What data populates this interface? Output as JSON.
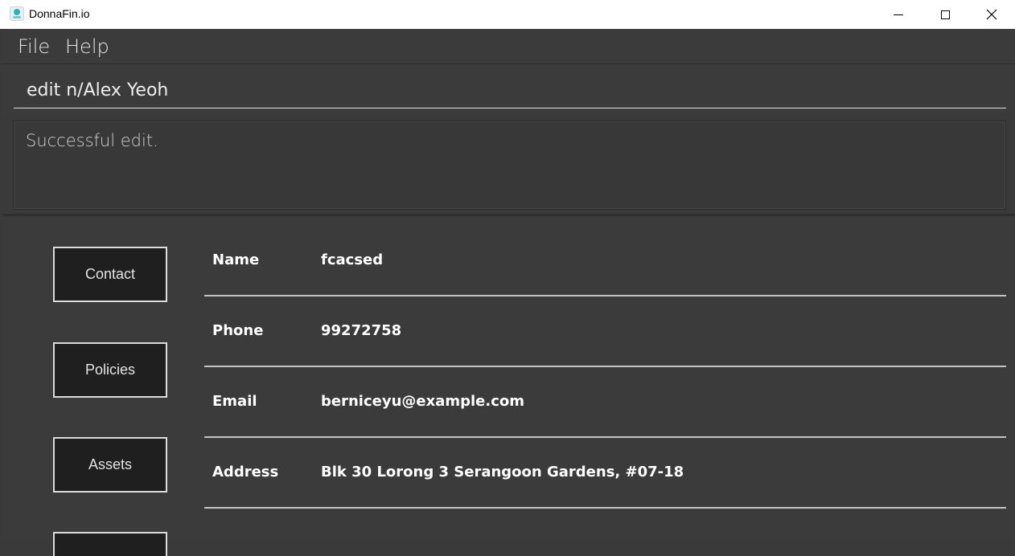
{
  "window": {
    "title": "DonnaFin.io"
  },
  "menu": {
    "file_label": "File",
    "help_label": "Help"
  },
  "command": {
    "value": "edit n/Alex Yeoh"
  },
  "result": {
    "message": "Successful edit."
  },
  "tabs": [
    {
      "label": "Contact"
    },
    {
      "label": "Policies"
    },
    {
      "label": "Assets"
    },
    {
      "label": ""
    }
  ],
  "contact": {
    "fields": [
      {
        "label": "Name",
        "value": "fcacsed"
      },
      {
        "label": "Phone",
        "value": "99272758"
      },
      {
        "label": "Email",
        "value": "berniceyu@example.com"
      },
      {
        "label": "Address",
        "value": "Blk 30 Lorong 3 Serangoon Gardens, #07-18"
      }
    ]
  },
  "icons": {
    "app": "donnafin-logo-icon",
    "minimize": "minimize-icon",
    "maximize": "maximize-icon",
    "close": "close-icon"
  },
  "colors": {
    "background": "#3b3b3b",
    "button_background": "#1f1f1f",
    "text": "#ffffff",
    "accent": "#2bb3b8"
  }
}
